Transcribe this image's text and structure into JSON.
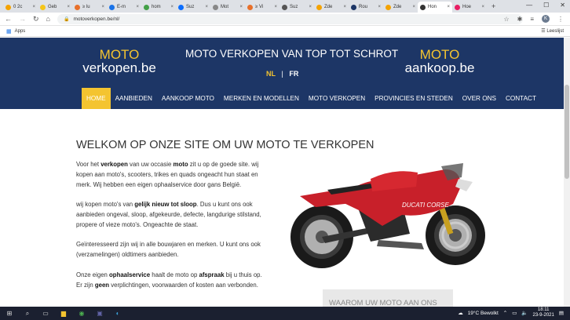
{
  "browser": {
    "tabs": [
      {
        "label": "0 2c",
        "color": "#f4a300"
      },
      {
        "label": "Geb",
        "color": "#f5c518"
      },
      {
        "label": "≥ lu",
        "color": "#e8702a"
      },
      {
        "label": "E-m",
        "color": "#1a73e8"
      },
      {
        "label": "hom",
        "color": "#43a047"
      },
      {
        "label": "Suz",
        "color": "#0d6efd"
      },
      {
        "label": "Mot",
        "color": "#888888"
      },
      {
        "label": "≥ Vi",
        "color": "#e8702a"
      },
      {
        "label": "Suz",
        "color": "#555555"
      },
      {
        "label": "Zde",
        "color": "#f4a300"
      },
      {
        "label": "Rou",
        "color": "#1d3666"
      },
      {
        "label": "Zde",
        "color": "#f4a300"
      },
      {
        "label": "Hon",
        "color": "#333333",
        "active": true
      },
      {
        "label": "Hoe",
        "color": "#e91e63"
      }
    ],
    "url": "motoverkopen.be/nl/",
    "bookmarks_apps": "Apps",
    "reading_list": "Leeslijst",
    "avatar_letter": "K"
  },
  "site": {
    "logo_left": {
      "top": "MOTO",
      "bottom": "verkopen.be"
    },
    "tagline": "MOTO VERKOPEN VAN TOP TOT SCHROT",
    "logo_right": {
      "top": "MOTO",
      "bottom": "aankoop.be"
    },
    "lang": {
      "nl": "NL",
      "sep": "|",
      "fr": "FR"
    },
    "menu": [
      "HOME",
      "AANBIEDEN",
      "AANKOOP MOTO",
      "MERKEN EN MODELLEN",
      "MOTO VERKOPEN",
      "PROVINCIES EN STEDEN",
      "OVER ONS",
      "CONTACT"
    ],
    "colors": {
      "navy": "#1d3666",
      "accent": "#f4c430"
    }
  },
  "content": {
    "title": "WELKOM OP ONZE SITE OM UW MOTO TE VERKOPEN",
    "p1": {
      "a": "Voor het ",
      "b": "verkopen",
      "c": " van uw occasie ",
      "d": "moto",
      "e": " zit u op de goede site. wij kopen aan moto's, scooters, trikes en quads  ongeacht hun staat en merk. Wij hebben een eigen ophaalservice door gans België."
    },
    "p2": {
      "a": "wij kopen moto's van ",
      "b": "gelijk nieuw tot sloop",
      "c": ". Dus u kunt ons ook aanbieden ongeval, sloop, afgekeurde, defecte, langdurige stilstand, propere of vieze moto's. Ongeachte de staat."
    },
    "p3": "Geïnteresseerd zijn wij in alle bouwjaren en merken. U kunt ons ook (verzamelingen) oldtimers aanbieden.",
    "p4": {
      "a": "Onze eigen ",
      "b": "ophaalservice",
      "c": " haalt de moto op ",
      "d": "afspraak",
      "e": " bij u thuis op. Er zijn ",
      "f": "geen",
      "g": " verplichtingen, voorwaarden of kosten aan verbonden."
    },
    "bike_brand": "DUCATI CORSE",
    "waarom": "WAAROM UW MOTO AAN ONS"
  },
  "taskbar": {
    "weather": "19°C  Bewolkt",
    "time": "18:11",
    "date": "23-9-2021"
  }
}
